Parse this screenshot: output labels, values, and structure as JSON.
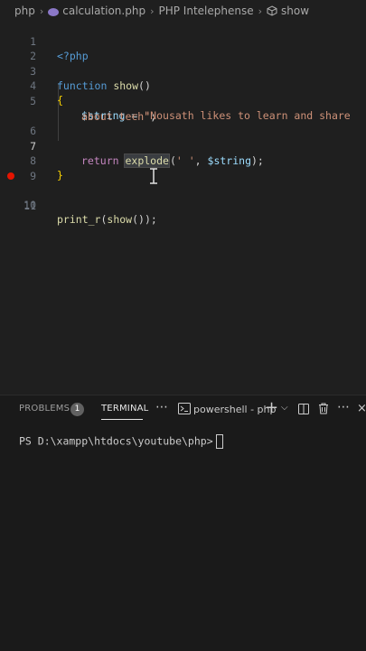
{
  "breadcrumb": {
    "items": [
      "php",
      "calculation.php",
      "PHP Intelephense",
      "show"
    ]
  },
  "editor": {
    "line_numbers": [
      "1",
      "2",
      "3",
      "4",
      "5",
      "6",
      "7",
      "8",
      "9",
      "10",
      "11"
    ],
    "active_line": "7",
    "breakpoint_line": "10",
    "lines": {
      "l1_tag": "<?php",
      "l3_kw": "function",
      "l3_fn": "show",
      "l3_paren": "()",
      "l4_brace": "{",
      "l5_var": "$string",
      "l5_eq": " = ",
      "l5_str": "\"Nousath likes to learn and share",
      "l5b_str": "about tech\"",
      "l5b_semi": ";",
      "l7_kw": "return",
      "l7_fn": "explode",
      "l7_open": "(",
      "l7_str": "' '",
      "l7_comma": ", ",
      "l7_var": "$string",
      "l7_close": ");",
      "l8_brace": "}",
      "l10_fn": "print_r",
      "l10_open": "(",
      "l10_fn2": "show",
      "l10_close": "());"
    }
  },
  "panel": {
    "tabs": {
      "problems": "PROBLEMS",
      "problems_count": "1",
      "terminal": "TERMINAL"
    },
    "terminal_profile": "powershell - php",
    "prompt": "PS D:\\xampp\\htdocs\\youtube\\php>"
  },
  "colors": {
    "background": "#1f1f1f",
    "breakpoint": "#e51400",
    "keyword": "#569cd6",
    "function": "#dcdcaa",
    "variable": "#9cdcfe",
    "string": "#ce9178"
  }
}
